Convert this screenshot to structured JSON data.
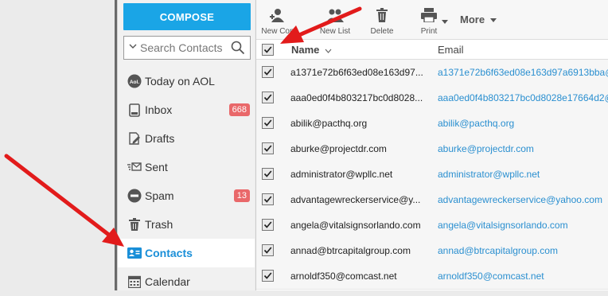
{
  "colors": {
    "accent": "#1aa5e6",
    "badge": "#e9686a",
    "link": "#2a8fd0",
    "active_label": "#1a8fd8",
    "arrow": "#e21b1b"
  },
  "compose_label": "COMPOSE",
  "search": {
    "placeholder": "Search Contacts"
  },
  "nav": [
    {
      "label": "Today on AOL",
      "icon": "aol-icon"
    },
    {
      "label": "Inbox",
      "icon": "inbox-icon",
      "badge": "668"
    },
    {
      "label": "Drafts",
      "icon": "drafts-icon"
    },
    {
      "label": "Sent",
      "icon": "sent-icon"
    },
    {
      "label": "Spam",
      "icon": "spam-icon",
      "badge": "13"
    },
    {
      "label": "Trash",
      "icon": "trash-icon"
    },
    {
      "label": "Contacts",
      "icon": "contacts-icon",
      "active": true
    },
    {
      "label": "Calendar",
      "icon": "calendar-icon"
    }
  ],
  "toolbar": {
    "new_contact": "New Con",
    "new_list": "New List",
    "delete": "Delete",
    "print": "Print",
    "more": "More"
  },
  "table": {
    "headers": {
      "name": "Name",
      "email": "Email"
    },
    "rows": [
      {
        "name": "a1371e72b6f63ed08e163d97...",
        "email": "a1371e72b6f63ed08e163d97a6913bba@"
      },
      {
        "name": "aaa0ed0f4b803217bc0d8028...",
        "email": "aaa0ed0f4b803217bc0d8028e17664d2@"
      },
      {
        "name": "abilik@pacthq.org",
        "email": "abilik@pacthq.org"
      },
      {
        "name": "aburke@projectdr.com",
        "email": "aburke@projectdr.com"
      },
      {
        "name": "administrator@wpllc.net",
        "email": "administrator@wpllc.net"
      },
      {
        "name": "advantagewreckerservice@y...",
        "email": "advantagewreckerservice@yahoo.com"
      },
      {
        "name": "angela@vitalsignsorlando.com",
        "email": "angela@vitalsignsorlando.com"
      },
      {
        "name": "annad@btrcapitalgroup.com",
        "email": "annad@btrcapitalgroup.com"
      },
      {
        "name": "arnoldf350@comcast.net",
        "email": "arnoldf350@comcast.net"
      }
    ]
  }
}
